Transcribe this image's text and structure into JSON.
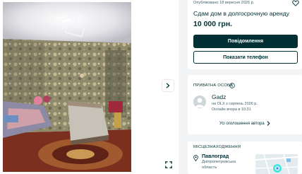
{
  "ad": {
    "published": "Опубліковано 18 вересня 2026 р.",
    "title": "Сдам дом в долгосрочную аренду",
    "price": "10 000 грн.",
    "message_button": "Повідомлення",
    "phone_button": "Показати телефон"
  },
  "seller": {
    "section_title": "ПРИВАТНА ОСОБА",
    "name": "Gadz",
    "since": "на OLX з серпень 2026 р.",
    "online": "Онлайн вчора в 10:31",
    "all_ads": "Усі оголошення автора"
  },
  "location": {
    "section_title": "МІСЦЕЗНАХОДЖЕННЯ",
    "city": "Павлоград",
    "region_line1": "Дніпропетровська",
    "region_line2": "область"
  },
  "icons": {
    "next": "chevron-right-icon",
    "expand": "expand-icon",
    "favorite": "heart-icon",
    "info": "info-icon",
    "pin": "location-pin-icon",
    "all_ads_arrow": "chevron-right-icon"
  },
  "colors": {
    "primary": "#002f34",
    "background": "#f2f4f5",
    "muted": "#406367"
  }
}
